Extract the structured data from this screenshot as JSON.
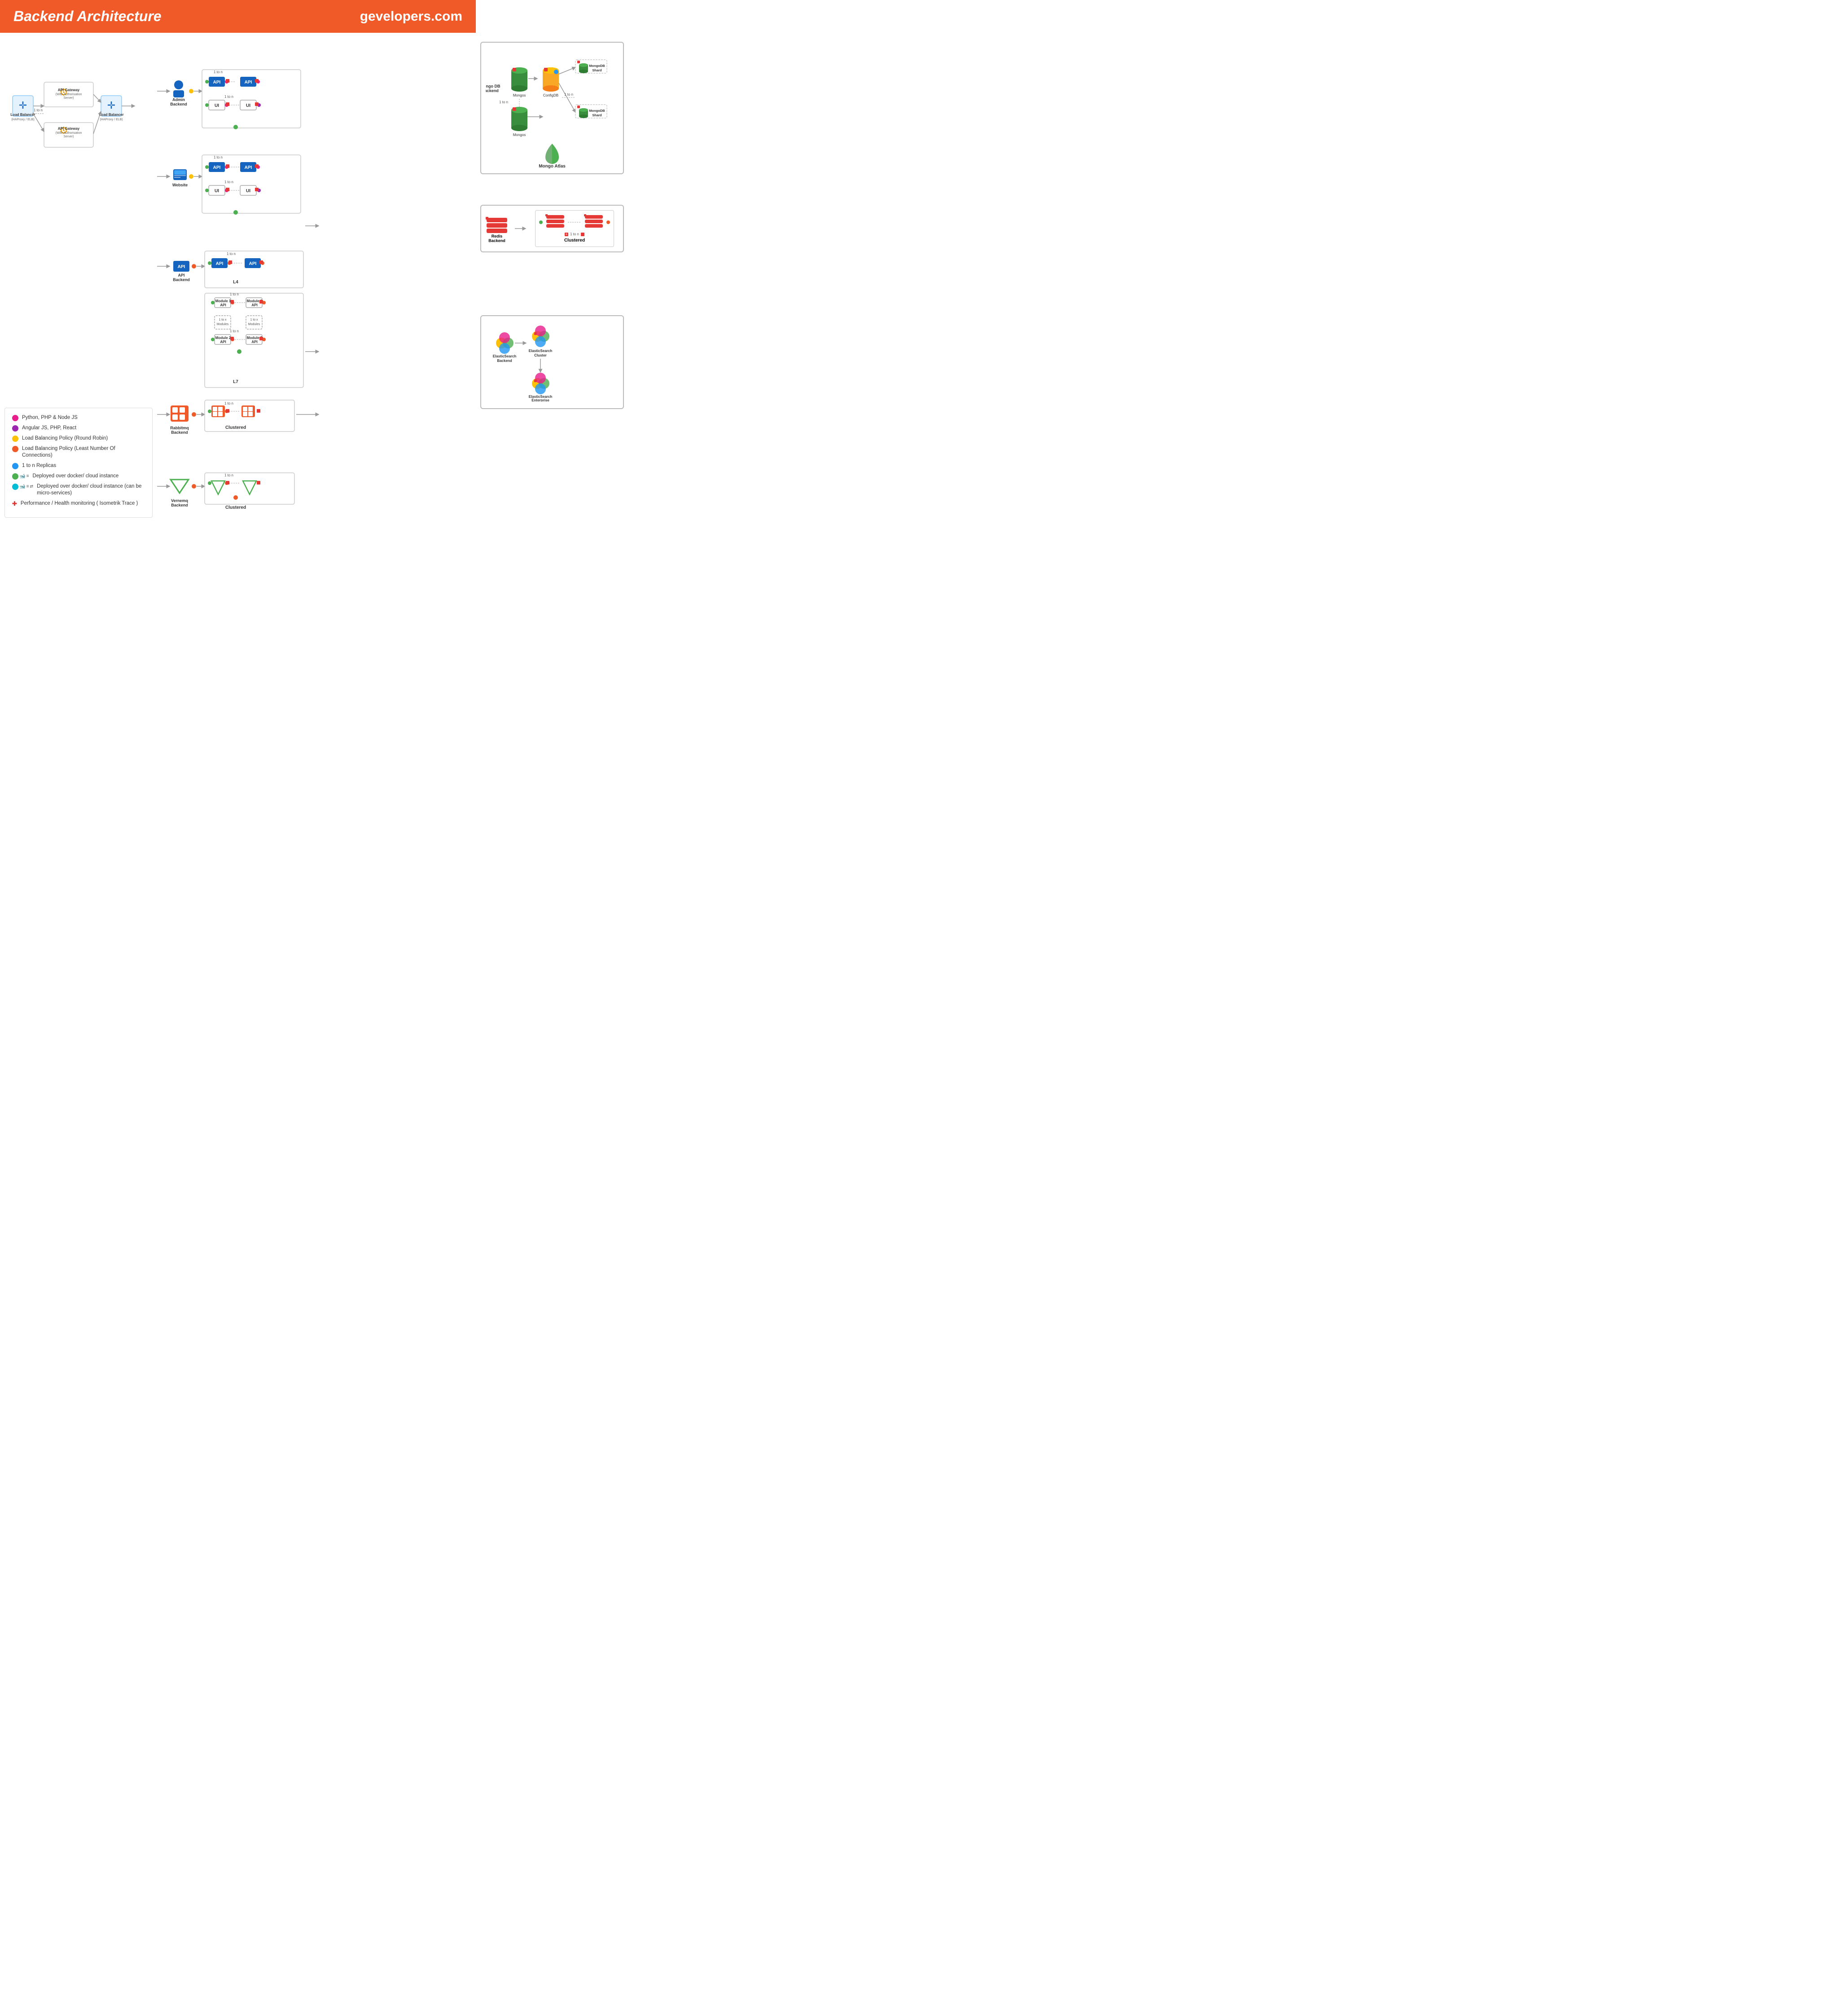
{
  "header": {
    "title": "Backend Architecture",
    "domain": "gevelopers.com"
  },
  "legend": {
    "items": [
      {
        "color": "pink",
        "text": "Python, PHP & Node JS"
      },
      {
        "color": "purple",
        "text": "Angular JS, PHP, React"
      },
      {
        "color": "yellow",
        "text": "Load Balancing Policy (Round Robin)"
      },
      {
        "color": "orange",
        "text": "Load Balancing Policy (Least Number Of Connections)"
      },
      {
        "color": "blue",
        "text": "1 to n Replicas"
      },
      {
        "color": "green",
        "text": "Deployed over docker/ cloud instance"
      },
      {
        "color": "teal",
        "text": "Deployed over docker/ cloud instance (can be micro-services)"
      },
      {
        "color": "red-cross",
        "text": "Performance / Health monitoring ( Isometrik Trace )"
      }
    ]
  },
  "sections": {
    "loadbalancer": {
      "label": "Load Balancer",
      "sublabel": "(HAProxy / ELB)",
      "one_to_n": "1 to n"
    },
    "apigateway1": {
      "label": "API Gateway",
      "sublabel": "(With Authorisation Server)"
    },
    "apigateway2": {
      "label": "API Gateway",
      "sublabel": "(With Authorisation Server)"
    },
    "loadbalancer2": {
      "label": "Load Balancer",
      "sublabel": "(HAProxy / ELB)"
    },
    "admin_backend": {
      "label": "Admin\nBackend"
    },
    "website": {
      "label": "Website"
    },
    "api_backend": {
      "label": "API\nBackend"
    },
    "rabbitmq_backend": {
      "label": "Rabbitmq\nBackend"
    },
    "vernemq_backend": {
      "label": "Vernemq\nBackend"
    },
    "redis_backend": {
      "label": "Redis\nBackend"
    },
    "elasticsearch_backend": {
      "label": "ElasticSearch\nBackend"
    },
    "mongo_backend": {
      "label": "Mongo DB\nBackend"
    },
    "l4": {
      "label": "L4"
    },
    "l7": {
      "label": "L7"
    },
    "clustered": {
      "label": "Clustered"
    },
    "one_to_n": "1 to n",
    "module1_api": "Module 1\nAPI",
    "module2_api": "Module 2\nAPI",
    "one_to_x_modules": "1 to x\nModules"
  },
  "colors": {
    "orange": "#f05a28",
    "blue": "#1565c0",
    "light_blue": "#42a5f5",
    "green": "#4caf50",
    "pink": "#e91e8c",
    "purple": "#9c27b0",
    "yellow": "#ffc107",
    "red": "#e53935",
    "teal": "#00bcd4",
    "gray": "#9e9e9e",
    "dark_blue": "#0d47a1"
  }
}
